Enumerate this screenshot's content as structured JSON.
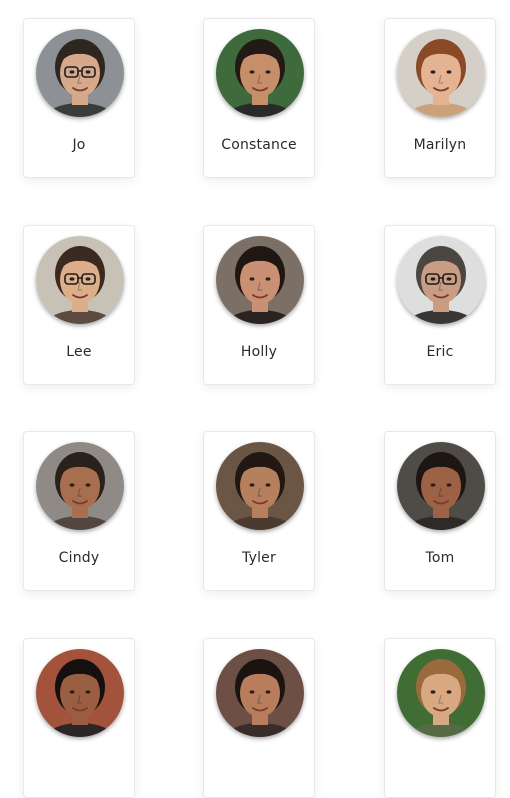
{
  "people": [
    {
      "name": "Jo",
      "skin": "#d6a98a",
      "hair": "#2f2620",
      "bg": "#8d9095",
      "glasses": true,
      "shirt": "#3b3b3b"
    },
    {
      "name": "Constance",
      "skin": "#c78e6a",
      "hair": "#231a16",
      "bg": "#3f6b3c",
      "glasses": false,
      "shirt": "#2a2a2a"
    },
    {
      "name": "Marilyn",
      "skin": "#e3b394",
      "hair": "#8a4a28",
      "bg": "#d4d0c7",
      "glasses": false,
      "shirt": "#c9a27a"
    },
    {
      "name": "Lee",
      "skin": "#dcae8a",
      "hair": "#3a2a1f",
      "bg": "#c8c1b6",
      "glasses": true,
      "shirt": "#5b4b42"
    },
    {
      "name": "Holly",
      "skin": "#c99073",
      "hair": "#201612",
      "bg": "#7c6f66",
      "glasses": false,
      "shirt": "#2b2322"
    },
    {
      "name": "Eric",
      "skin": "#c89d84",
      "hair": "#4c4640",
      "bg": "#dedede",
      "glasses": true,
      "shirt": "#3a3633"
    },
    {
      "name": "Cindy",
      "skin": "#a86e50",
      "hair": "#2b211b",
      "bg": "#8f8a85",
      "glasses": false,
      "shirt": "#524740"
    },
    {
      "name": "Tyler",
      "skin": "#b67f5e",
      "hair": "#211813",
      "bg": "#6b5545",
      "glasses": false,
      "shirt": "#4a3a2f"
    },
    {
      "name": "Tom",
      "skin": "#9d6246",
      "hair": "#1e1612",
      "bg": "#4f4b47",
      "glasses": false,
      "shirt": "#2d2a28"
    },
    {
      "name": "",
      "skin": "#9a5e42",
      "hair": "#141010",
      "bg": "#a3523b",
      "glasses": false,
      "shirt": "#2b2523"
    },
    {
      "name": "",
      "skin": "#b77d5c",
      "hair": "#1a1411",
      "bg": "#6d4f45",
      "glasses": false,
      "shirt": "#3a2c28"
    },
    {
      "name": "",
      "skin": "#d8a882",
      "hair": "#9a6a3c",
      "bg": "#3f6d34",
      "glasses": false,
      "shirt": "#566b45"
    }
  ]
}
